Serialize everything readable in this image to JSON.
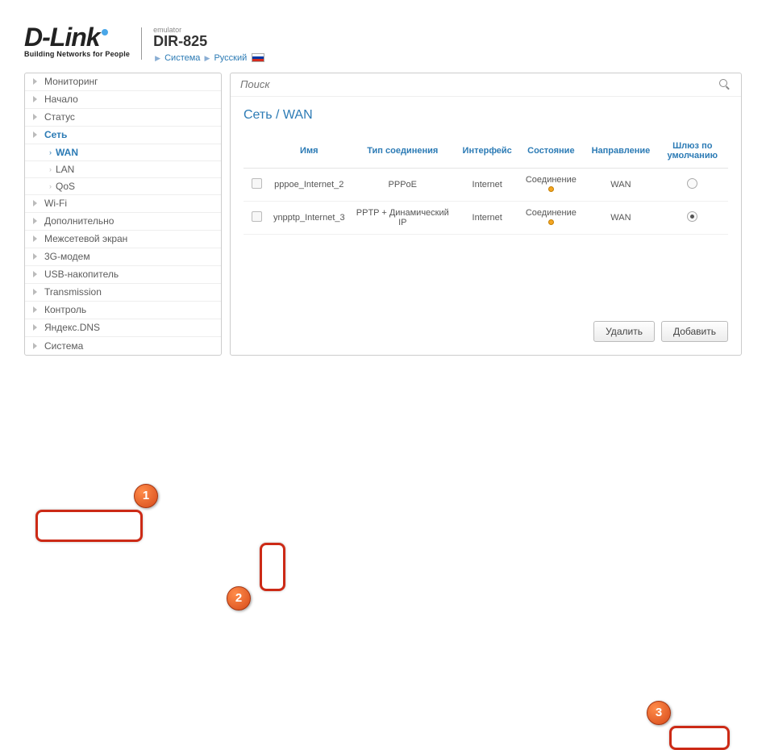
{
  "header": {
    "logo_text": "D-Link",
    "tagline": "Building Networks for People",
    "emulator_label": "emulator",
    "model": "DIR-825",
    "crumb1": "Система",
    "crumb2": "Русский"
  },
  "sidebar": {
    "items": [
      {
        "label": "Мониторинг"
      },
      {
        "label": "Начало"
      },
      {
        "label": "Статус"
      },
      {
        "label": "Сеть"
      },
      {
        "label": "Wi-Fi"
      },
      {
        "label": "Дополнительно"
      },
      {
        "label": "Межсетевой экран"
      },
      {
        "label": "3G-модем"
      },
      {
        "label": "USB-накопитель"
      },
      {
        "label": "Transmission"
      },
      {
        "label": "Контроль"
      },
      {
        "label": "Яндекс.DNS"
      },
      {
        "label": "Система"
      }
    ],
    "subitems": [
      {
        "label": "WAN"
      },
      {
        "label": "LAN"
      },
      {
        "label": "QoS"
      }
    ]
  },
  "search": {
    "placeholder": "Поиск"
  },
  "main": {
    "title": "Сеть  /  WAN",
    "columns": {
      "name": "Имя",
      "type": "Тип соединения",
      "iface": "Интерфейс",
      "state": "Состояние",
      "dir": "Направление",
      "gw": "Шлюз по умолчанию"
    },
    "rows": [
      {
        "name": "pppoe_Internet_2",
        "type": "PPPoE",
        "iface": "Internet",
        "state": "Соединение",
        "dir": "WAN",
        "gw": false
      },
      {
        "name": "ynpptp_Internet_3",
        "type": "PPTP + Динамический IP",
        "iface": "Internet",
        "state": "Соединение",
        "dir": "WAN",
        "gw": true
      }
    ],
    "buttons": {
      "delete": "Удалить",
      "add": "Добавить"
    }
  },
  "callouts": {
    "c1": "1",
    "c2": "2",
    "c3": "3"
  }
}
